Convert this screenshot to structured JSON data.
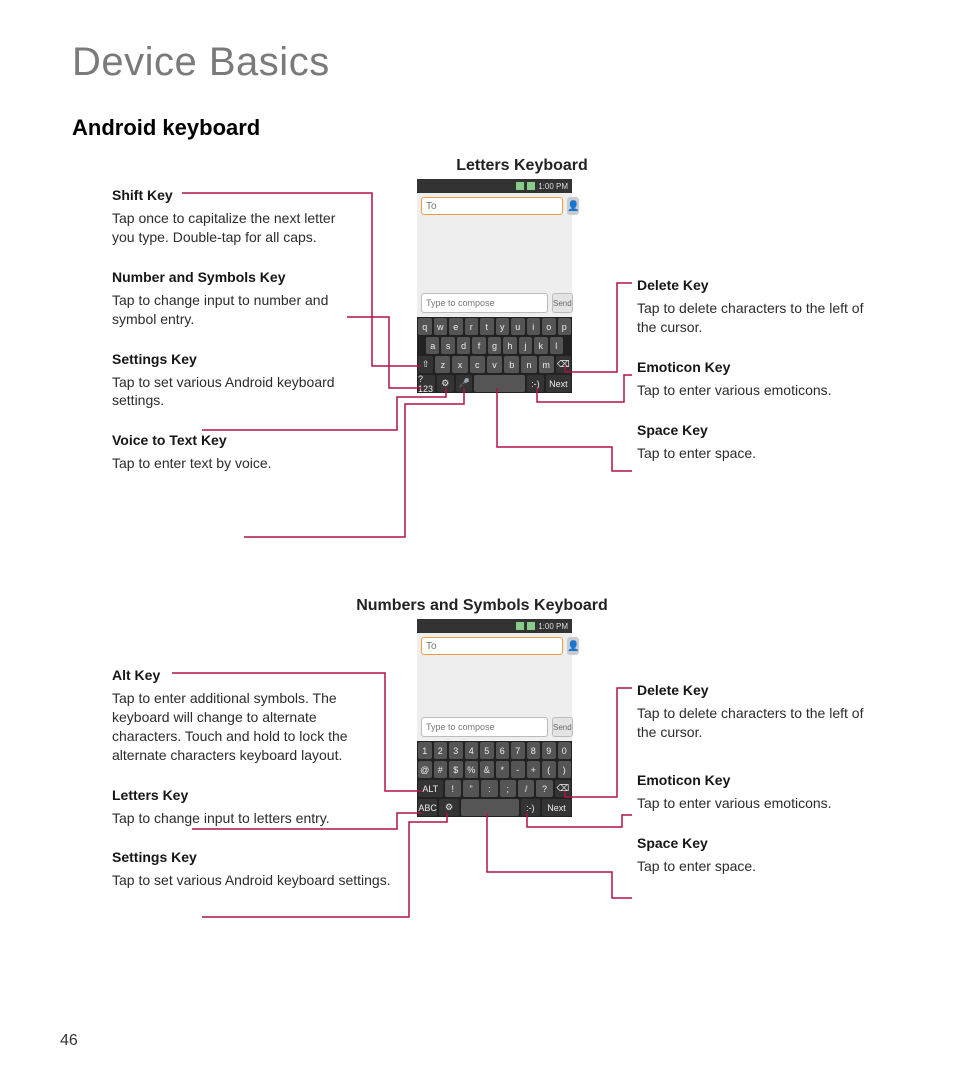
{
  "page": {
    "title": "Device Basics",
    "number": "46"
  },
  "section": {
    "heading": "Android keyboard",
    "letters_heading": "Letters Keyboard",
    "numbers_heading": "Numbers and Symbols Keyboard"
  },
  "phone": {
    "time": "1:00 PM",
    "to_placeholder": "To",
    "compose_placeholder": "Type to compose",
    "send_label": "Send",
    "letters_rows": [
      [
        "q",
        "w",
        "e",
        "r",
        "t",
        "y",
        "u",
        "i",
        "o",
        "p"
      ],
      [
        "a",
        "s",
        "d",
        "f",
        "g",
        "h",
        "j",
        "k",
        "l"
      ],
      [
        "⇧",
        "z",
        "x",
        "c",
        "v",
        "b",
        "n",
        "m",
        "⌫"
      ]
    ],
    "letters_bottom_left": "?123",
    "letters_bottom_next": "Next",
    "numbers_rows": [
      [
        "1",
        "2",
        "3",
        "4",
        "5",
        "6",
        "7",
        "8",
        "9",
        "0"
      ],
      [
        "@",
        "#",
        "$",
        "%",
        "&",
        "*",
        "-",
        "+",
        "(",
        ")"
      ],
      [
        "ALT",
        "!",
        "\"",
        ":",
        ";",
        "/",
        "?",
        "⌫"
      ]
    ],
    "numbers_bottom_left": "ABC",
    "numbers_bottom_next": "Next",
    "smiley": ":-)",
    "mic": "🎤",
    "gear": "⚙"
  },
  "letters_labels": {
    "left": [
      {
        "title": "Shift Key",
        "desc": "Tap once to capitalize the next letter you type. Double-tap for all caps."
      },
      {
        "title": "Number and Symbols Key",
        "desc": "Tap to change input to number and symbol entry."
      },
      {
        "title": "Settings Key",
        "desc": "Tap to set various Android keyboard settings."
      },
      {
        "title": "Voice to Text Key",
        "desc": "Tap to enter text by voice."
      }
    ],
    "right": [
      {
        "title": "Delete Key",
        "desc": "Tap to delete characters to the left of the cursor."
      },
      {
        "title": "Emoticon Key",
        "desc": "Tap to enter various emoticons."
      },
      {
        "title": "Space Key",
        "desc": "Tap to enter space."
      }
    ]
  },
  "numbers_labels": {
    "left": [
      {
        "title": "Alt Key",
        "desc": "Tap to enter additional symbols. The keyboard will change to alternate characters. Touch and hold to lock the alternate characters keyboard layout."
      },
      {
        "title": "Letters Key",
        "desc": "Tap to change input to letters entry."
      },
      {
        "title": "Settings Key",
        "desc": "Tap to set various Android keyboard settings."
      }
    ],
    "right": [
      {
        "title": "Delete Key",
        "desc": "Tap to delete characters to the left of the cursor."
      },
      {
        "title": "Emoticon Key",
        "desc": "Tap to enter various emoticons."
      },
      {
        "title": "Space Key",
        "desc": "Tap to enter space."
      }
    ]
  },
  "colors": {
    "callout_line": "#b01048"
  }
}
